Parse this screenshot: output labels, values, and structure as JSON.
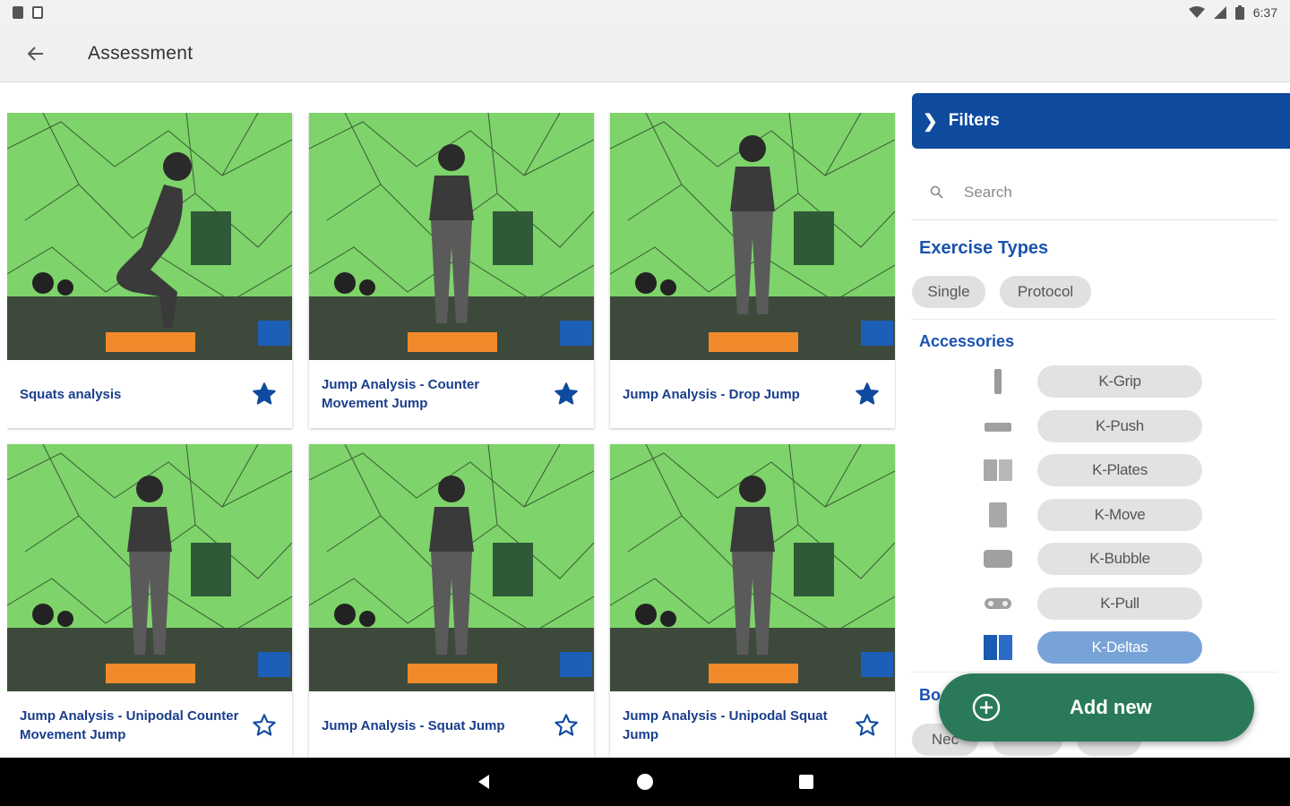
{
  "status_bar": {
    "time": "6:37"
  },
  "app_bar": {
    "title": "Assessment"
  },
  "cards": [
    {
      "title": "Squats analysis",
      "favorited": true
    },
    {
      "title": "Jump Analysis - Counter Movement Jump",
      "favorited": true
    },
    {
      "title": "Jump Analysis - Drop Jump",
      "favorited": true
    },
    {
      "title": "Jump Analysis - Unipodal Counter Movement Jump",
      "favorited": false
    },
    {
      "title": "Jump Analysis - Squat Jump",
      "favorited": false
    },
    {
      "title": "Jump Analysis - Unipodal Squat Jump",
      "favorited": false
    }
  ],
  "filters": {
    "header": "Filters",
    "search_placeholder": "Search",
    "exercise_types": {
      "title": "Exercise Types",
      "options": [
        "Single",
        "Protocol"
      ]
    },
    "accessories": {
      "title": "Accessories",
      "items": [
        {
          "label": "K-Grip",
          "icon": "k-grip-icon",
          "selected": false
        },
        {
          "label": "K-Push",
          "icon": "k-push-icon",
          "selected": false
        },
        {
          "label": "K-Plates",
          "icon": "k-plates-icon",
          "selected": false
        },
        {
          "label": "K-Move",
          "icon": "k-move-icon",
          "selected": false
        },
        {
          "label": "K-Bubble",
          "icon": "k-bubble-icon",
          "selected": false
        },
        {
          "label": "K-Pull",
          "icon": "k-pull-icon",
          "selected": false
        },
        {
          "label": "K-Deltas",
          "icon": "k-deltas-icon",
          "selected": true
        }
      ]
    },
    "body_section_partial": "Bo",
    "body_chips_partial": [
      "Nec",
      "",
      ""
    ]
  },
  "fab": {
    "label": "Add new"
  },
  "colors": {
    "primary": "#0e4a9e",
    "title_text": "#1a3e8c",
    "fab": "#2a7a5a",
    "selected_chip": "#78a3d8"
  }
}
